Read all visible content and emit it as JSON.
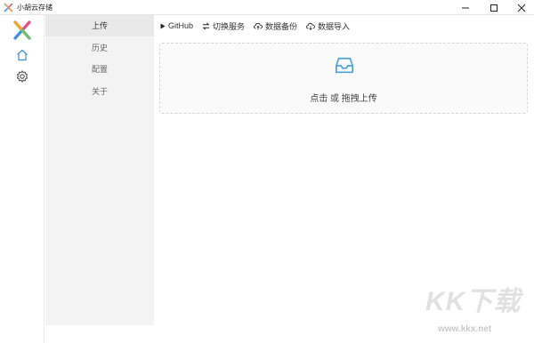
{
  "window": {
    "title": "小胡云存储",
    "minimize_icon": "minimize-icon",
    "maximize_icon": "maximize-icon",
    "close_icon": "close-icon"
  },
  "rail": {
    "logo_icon": "app-logo-icon",
    "home_icon": "home-icon",
    "settings_icon": "gear-icon",
    "accent_color": "#3a8ee6"
  },
  "sidebar": {
    "items": [
      {
        "label": "上传",
        "active": true
      },
      {
        "label": "历史",
        "active": false
      },
      {
        "label": "配置",
        "active": false
      },
      {
        "label": "关于",
        "active": false
      }
    ]
  },
  "toolbar": {
    "github": "GitHub",
    "switch_service": "切换服务",
    "backup": "数据备份",
    "import": "数据导入"
  },
  "upload": {
    "icon": "inbox-icon",
    "text": "点击 或 拖拽上传",
    "icon_color": "#4aa3df"
  },
  "watermark": {
    "main": "KK下载",
    "url": "www.kkx.net"
  }
}
